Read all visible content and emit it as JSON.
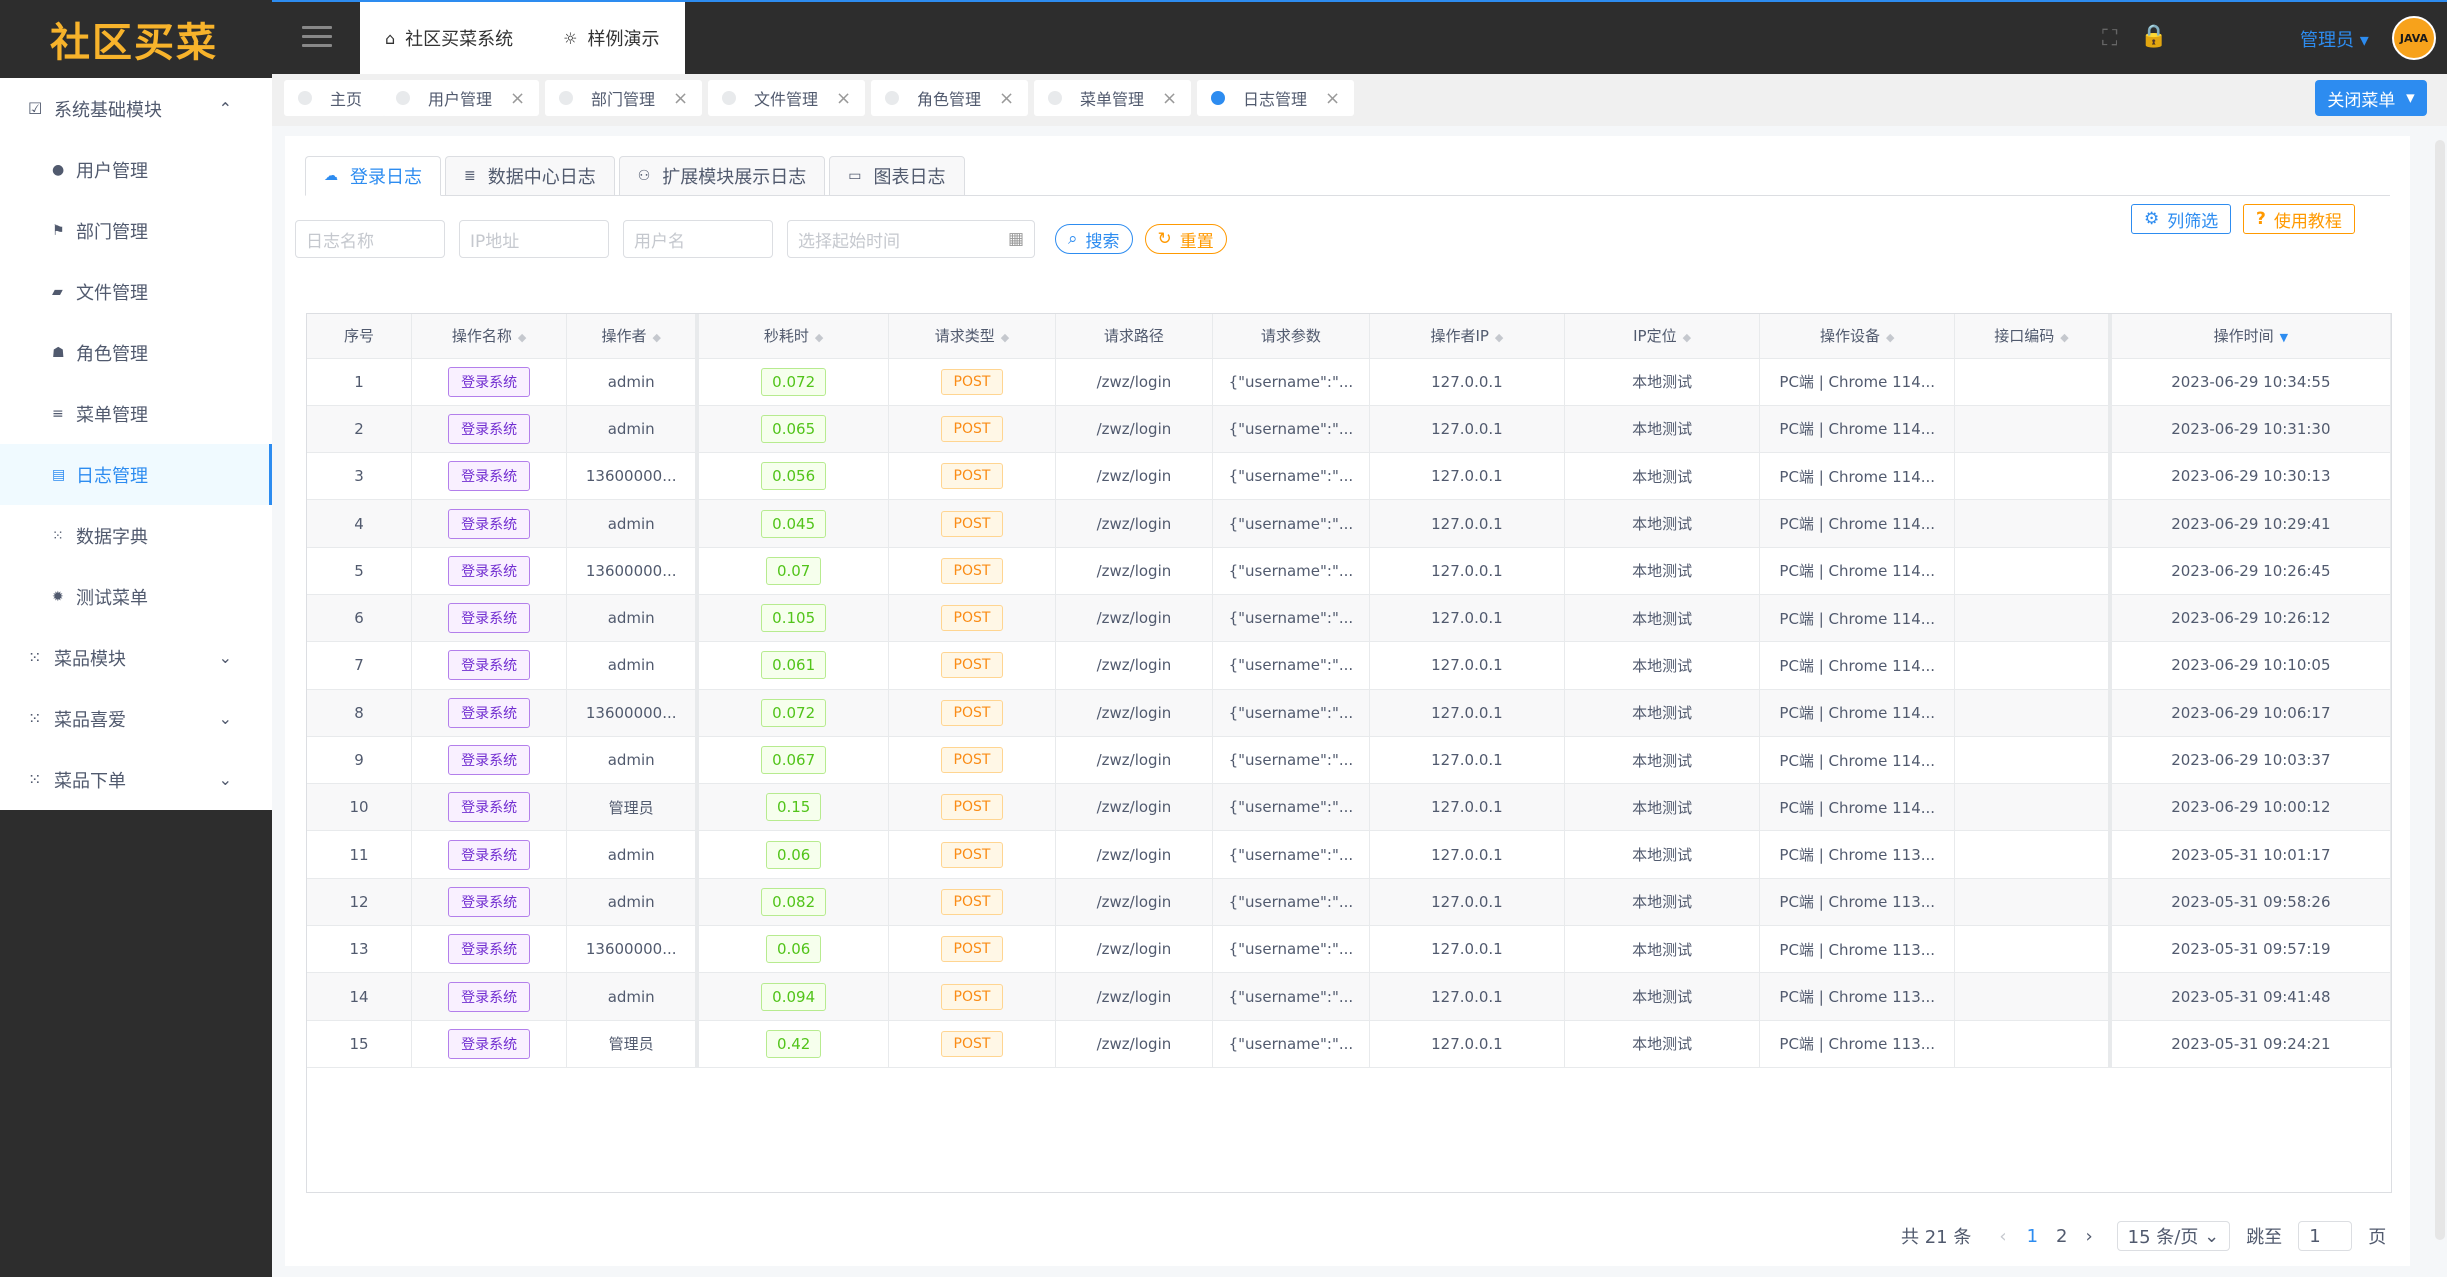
{
  "app": {
    "logo": "社区买菜"
  },
  "header": {
    "tabs": [
      {
        "icon": "home-icon",
        "label": "社区买菜系统"
      },
      {
        "icon": "bulb-icon",
        "label": "样例演示"
      }
    ],
    "user": "管理员",
    "avatar_text": "JAVA"
  },
  "sidebar": {
    "groups": [
      {
        "label": "系统基础模块",
        "icon": "check-square-icon",
        "expanded": true,
        "items": [
          {
            "label": "用户管理",
            "icon": "user-icon"
          },
          {
            "label": "部门管理",
            "icon": "flag-icon"
          },
          {
            "label": "文件管理",
            "icon": "folder-icon"
          },
          {
            "label": "角色管理",
            "icon": "team-icon"
          },
          {
            "label": "菜单管理",
            "icon": "menu-icon"
          },
          {
            "label": "日志管理",
            "icon": "log-icon",
            "active": true
          },
          {
            "label": "数据字典",
            "icon": "grid-icon"
          },
          {
            "label": "测试菜单",
            "icon": "bug-icon"
          }
        ]
      },
      {
        "label": "菜品模块",
        "icon": "grid-icon"
      },
      {
        "label": "菜品喜爱",
        "icon": "grid-icon"
      },
      {
        "label": "菜品下单",
        "icon": "grid-icon"
      }
    ]
  },
  "tagbar": {
    "tags": [
      {
        "label": "主页",
        "closable": false
      },
      {
        "label": "用户管理",
        "closable": true
      },
      {
        "label": "部门管理",
        "closable": true
      },
      {
        "label": "文件管理",
        "closable": true
      },
      {
        "label": "角色管理",
        "closable": true
      },
      {
        "label": "菜单管理",
        "closable": true
      },
      {
        "label": "日志管理",
        "closable": true,
        "active": true
      }
    ],
    "close_menu": "关闭菜单"
  },
  "inner_tabs": [
    {
      "label": "登录日志",
      "active": true
    },
    {
      "label": "数据中心日志"
    },
    {
      "label": "扩展模块展示日志"
    },
    {
      "label": "图表日志"
    }
  ],
  "filters": {
    "log_name_placeholder": "日志名称",
    "ip_placeholder": "IP地址",
    "user_placeholder": "用户名",
    "date_placeholder": "选择起始时间",
    "search_label": "搜索",
    "reset_label": "重置",
    "column_filter_label": "列筛选",
    "tutorial_label": "使用教程"
  },
  "table": {
    "columns": [
      "序号",
      "操作名称",
      "操作者",
      "秒耗时",
      "请求类型",
      "请求路径",
      "请求参数",
      "操作者IP",
      "IP定位",
      "操作设备",
      "接口编码",
      "操作时间"
    ],
    "rows": [
      [
        "1",
        "登录系统",
        "admin",
        "0.072",
        "POST",
        "/zwz/login",
        "{\"username\":\"...",
        "127.0.0.1",
        "本地测试",
        "PC端 | Chrome 114...",
        "",
        "2023-06-29 10:34:55"
      ],
      [
        "2",
        "登录系统",
        "admin",
        "0.065",
        "POST",
        "/zwz/login",
        "{\"username\":\"...",
        "127.0.0.1",
        "本地测试",
        "PC端 | Chrome 114...",
        "",
        "2023-06-29 10:31:30"
      ],
      [
        "3",
        "登录系统",
        "13600000...",
        "0.056",
        "POST",
        "/zwz/login",
        "{\"username\":\"...",
        "127.0.0.1",
        "本地测试",
        "PC端 | Chrome 114...",
        "",
        "2023-06-29 10:30:13"
      ],
      [
        "4",
        "登录系统",
        "admin",
        "0.045",
        "POST",
        "/zwz/login",
        "{\"username\":\"...",
        "127.0.0.1",
        "本地测试",
        "PC端 | Chrome 114...",
        "",
        "2023-06-29 10:29:41"
      ],
      [
        "5",
        "登录系统",
        "13600000...",
        "0.07",
        "POST",
        "/zwz/login",
        "{\"username\":\"...",
        "127.0.0.1",
        "本地测试",
        "PC端 | Chrome 114...",
        "",
        "2023-06-29 10:26:45"
      ],
      [
        "6",
        "登录系统",
        "admin",
        "0.105",
        "POST",
        "/zwz/login",
        "{\"username\":\"...",
        "127.0.0.1",
        "本地测试",
        "PC端 | Chrome 114...",
        "",
        "2023-06-29 10:26:12"
      ],
      [
        "7",
        "登录系统",
        "admin",
        "0.061",
        "POST",
        "/zwz/login",
        "{\"username\":\"...",
        "127.0.0.1",
        "本地测试",
        "PC端 | Chrome 114...",
        "",
        "2023-06-29 10:10:05"
      ],
      [
        "8",
        "登录系统",
        "13600000...",
        "0.072",
        "POST",
        "/zwz/login",
        "{\"username\":\"...",
        "127.0.0.1",
        "本地测试",
        "PC端 | Chrome 114...",
        "",
        "2023-06-29 10:06:17"
      ],
      [
        "9",
        "登录系统",
        "admin",
        "0.067",
        "POST",
        "/zwz/login",
        "{\"username\":\"...",
        "127.0.0.1",
        "本地测试",
        "PC端 | Chrome 114...",
        "",
        "2023-06-29 10:03:37"
      ],
      [
        "10",
        "登录系统",
        "管理员",
        "0.15",
        "POST",
        "/zwz/login",
        "{\"username\":\"...",
        "127.0.0.1",
        "本地测试",
        "PC端 | Chrome 114...",
        "",
        "2023-06-29 10:00:12"
      ],
      [
        "11",
        "登录系统",
        "admin",
        "0.06",
        "POST",
        "/zwz/login",
        "{\"username\":\"...",
        "127.0.0.1",
        "本地测试",
        "PC端 | Chrome 113...",
        "",
        "2023-05-31 10:01:17"
      ],
      [
        "12",
        "登录系统",
        "admin",
        "0.082",
        "POST",
        "/zwz/login",
        "{\"username\":\"...",
        "127.0.0.1",
        "本地测试",
        "PC端 | Chrome 113...",
        "",
        "2023-05-31 09:58:26"
      ],
      [
        "13",
        "登录系统",
        "13600000...",
        "0.06",
        "POST",
        "/zwz/login",
        "{\"username\":\"...",
        "127.0.0.1",
        "本地测试",
        "PC端 | Chrome 113...",
        "",
        "2023-05-31 09:57:19"
      ],
      [
        "14",
        "登录系统",
        "admin",
        "0.094",
        "POST",
        "/zwz/login",
        "{\"username\":\"...",
        "127.0.0.1",
        "本地测试",
        "PC端 | Chrome 113...",
        "",
        "2023-05-31 09:41:48"
      ],
      [
        "15",
        "登录系统",
        "管理员",
        "0.42",
        "POST",
        "/zwz/login",
        "{\"username\":\"...",
        "127.0.0.1",
        "本地测试",
        "PC端 | Chrome 113...",
        "",
        "2023-05-31 09:24:21"
      ]
    ]
  },
  "pagination": {
    "total": "共 21 条",
    "pages": [
      "1",
      "2"
    ],
    "current": "1",
    "page_size": "15 条/页",
    "jump_label": "跳至",
    "jump_value": "1",
    "page_unit": "页"
  },
  "colors": {
    "accent": "#2d8cf0",
    "logo": "#f7b32b",
    "warning": "#ff9900"
  }
}
